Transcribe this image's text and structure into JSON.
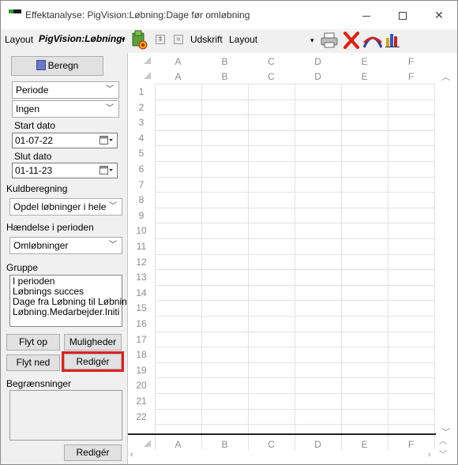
{
  "window": {
    "title": "Effektanalyse: PigVision:Løbning:Dage før omløbning"
  },
  "toolbar": {
    "layout_label": "Layout",
    "layout_value": "PigVision:Løbning:",
    "udskrift_label": "Udskrift",
    "layout2_value": "Layout"
  },
  "left": {
    "beregn_label": "Beregn",
    "periode_value": "Periode",
    "ingen_value": "Ingen",
    "start_label": "Start dato",
    "start_value": "01-07-22",
    "slut_label": "Slut dato",
    "slut_value": "01-11-23",
    "kuld_label": "Kuldberegning",
    "kuld_value": "Opdel løbninger i hele kuld",
    "haendelse_label": "Hændelse i perioden",
    "haendelse_value": "Omløbninger",
    "gruppe_label": "Gruppe",
    "gruppe_items": [
      "I perioden",
      "Løbnings succes",
      "Dage fra Løbning til Løbning",
      "Løbning.Medarbejder.Initialer"
    ],
    "flyt_op": "Flyt op",
    "muligheder": "Muligheder",
    "flyt_ned": "Flyt ned",
    "rediger": "Redigér",
    "begr_label": "Begrænsninger",
    "rediger2": "Redigér"
  },
  "grid": {
    "columns": [
      "A",
      "B",
      "C",
      "D",
      "E",
      "F"
    ],
    "rows": [
      "1",
      "2",
      "3",
      "4",
      "5",
      "6",
      "7",
      "8",
      "9",
      "10",
      "11",
      "12",
      "13",
      "14",
      "15",
      "16",
      "17",
      "18",
      "19",
      "20",
      "21",
      "22"
    ]
  },
  "colors": {
    "highlight": "#e02020",
    "grid_header_text": "#8c8c8c"
  }
}
